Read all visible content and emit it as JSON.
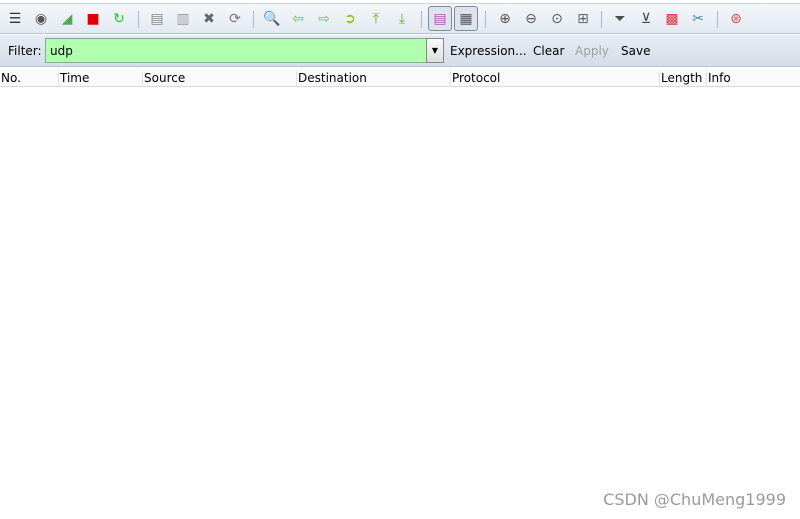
{
  "toolbar": {
    "buttons": [
      {
        "name": "interfaces-icon",
        "glyph": "☰",
        "color": "#333"
      },
      {
        "name": "capture-options-icon",
        "glyph": "◉",
        "color": "#555"
      },
      {
        "name": "start-capture-icon",
        "glyph": "◢",
        "color": "#5a5"
      },
      {
        "name": "stop-capture-icon",
        "glyph": "■",
        "color": "#e00000"
      },
      {
        "name": "restart-capture-icon",
        "glyph": "↻",
        "color": "#2c2"
      },
      {
        "name": "open-file-icon",
        "glyph": "▤",
        "color": "#888"
      },
      {
        "name": "save-file-icon",
        "glyph": "▥",
        "color": "#999"
      },
      {
        "name": "close-file-icon",
        "glyph": "✖",
        "color": "#666"
      },
      {
        "name": "reload-icon",
        "glyph": "⟳",
        "color": "#777"
      },
      {
        "name": "find-packet-icon",
        "glyph": "🔍",
        "color": "#666"
      },
      {
        "name": "go-back-icon",
        "glyph": "⇦",
        "color": "#6c2"
      },
      {
        "name": "go-forward-icon",
        "glyph": "⇨",
        "color": "#6c2"
      },
      {
        "name": "go-to-packet-icon",
        "glyph": "➲",
        "color": "#9b2"
      },
      {
        "name": "first-packet-icon",
        "glyph": "⤒",
        "color": "#5b1"
      },
      {
        "name": "last-packet-icon",
        "glyph": "⤓",
        "color": "#5b1"
      },
      {
        "name": "colorize-icon",
        "glyph": "▤",
        "color": "#a5a",
        "pressed": true
      },
      {
        "name": "auto-scroll-icon",
        "glyph": "▦",
        "color": "#555",
        "pressed": true
      },
      {
        "name": "zoom-in-icon",
        "glyph": "⊕",
        "color": "#555"
      },
      {
        "name": "zoom-out-icon",
        "glyph": "⊖",
        "color": "#555"
      },
      {
        "name": "zoom-normal-icon",
        "glyph": "⊙",
        "color": "#555"
      },
      {
        "name": "resize-columns-icon",
        "glyph": "⊞",
        "color": "#666"
      },
      {
        "name": "capture-filters-icon",
        "glyph": "⏷",
        "color": "#454"
      },
      {
        "name": "display-filters-icon",
        "glyph": "⊻",
        "color": "#444"
      },
      {
        "name": "coloring-rules-icon",
        "glyph": "▩",
        "color": "#d33"
      },
      {
        "name": "preferences-icon",
        "glyph": "✂",
        "color": "#48a"
      },
      {
        "name": "help-icon",
        "glyph": "⊛",
        "color": "#d44"
      }
    ]
  },
  "filter": {
    "label": "Filter:",
    "value": "udp",
    "bg_color": "#afffaf",
    "expression": "Expression...",
    "clear": "Clear",
    "apply": "Apply",
    "save": "Save"
  },
  "columns": [
    "No.",
    "Time",
    "Source",
    "Destination",
    "Protocol",
    "Length",
    "Info"
  ],
  "watermark": "CSDN @ChuMeng1999"
}
